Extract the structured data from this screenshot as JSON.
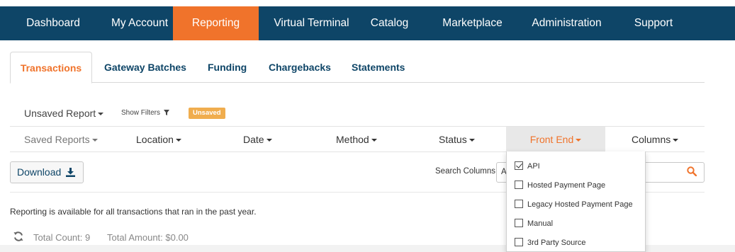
{
  "colors": {
    "nav_bg": "#0e4567",
    "accent": "#f0732b",
    "badge": "#f0ad4e"
  },
  "topnav": {
    "items": [
      {
        "label": "Dashboard"
      },
      {
        "label": "My Account"
      },
      {
        "label": "Reporting",
        "active": true
      },
      {
        "label": "Virtual Terminal"
      },
      {
        "label": "Catalog"
      },
      {
        "label": "Marketplace"
      },
      {
        "label": "Administration"
      },
      {
        "label": "Support"
      }
    ]
  },
  "subtabs": {
    "items": [
      {
        "label": "Transactions",
        "active": true
      },
      {
        "label": "Gateway Batches"
      },
      {
        "label": "Funding"
      },
      {
        "label": "Chargebacks"
      },
      {
        "label": "Statements"
      }
    ]
  },
  "report": {
    "unsaved_label": "Unsaved Report",
    "show_filters_label": "Show Filters",
    "badge": "Unsaved"
  },
  "filters": {
    "saved_reports": "Saved Reports",
    "location": "Location",
    "date": "Date",
    "method": "Method",
    "status": "Status",
    "front_end": "Front End",
    "columns": "Columns"
  },
  "toolbar": {
    "download_label": "Download",
    "download_icon": "download-icon",
    "search_label": "Search Columns:",
    "search_value": "A",
    "search_icon": "search-icon"
  },
  "front_end_dropdown": {
    "options": [
      {
        "label": "API",
        "checked": true
      },
      {
        "label": "Hosted Payment Page",
        "checked": false
      },
      {
        "label": "Legacy Hosted Payment Page",
        "checked": false
      },
      {
        "label": "Manual",
        "checked": false
      },
      {
        "label": "3rd Party Source",
        "checked": false
      }
    ]
  },
  "info": {
    "notice": "Reporting is available for all transactions that ran in the past year.",
    "total_count": "Total Count: 9",
    "total_amount": "Total Amount: $0.00",
    "refresh_icon": "refresh-icon"
  }
}
